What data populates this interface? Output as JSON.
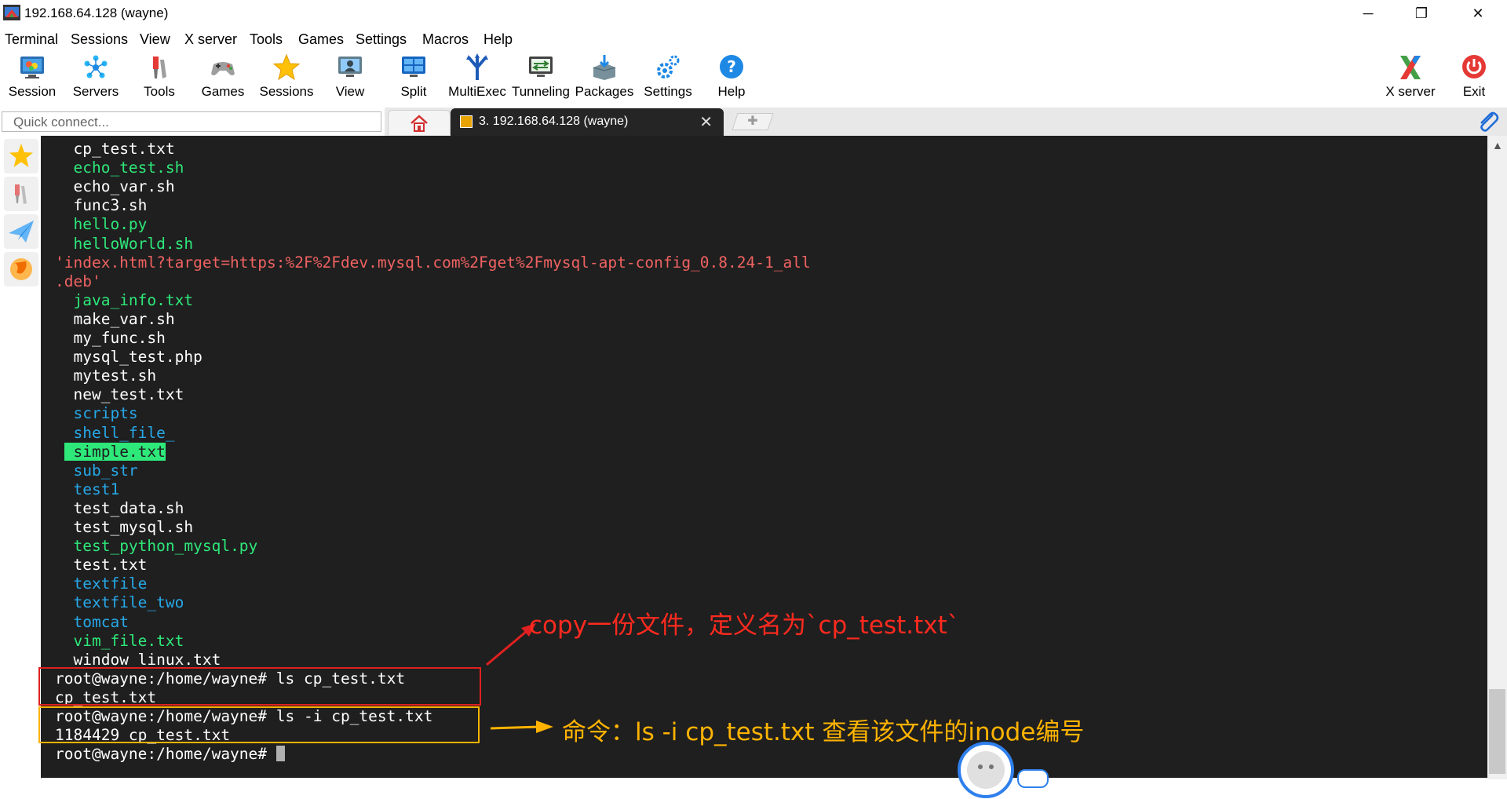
{
  "window": {
    "title": "192.168.64.128 (wayne)",
    "minimize_glyph": "─",
    "restore_glyph": "❐",
    "close_glyph": "✕"
  },
  "menu": [
    "Terminal",
    "Sessions",
    "View",
    "X server",
    "Tools",
    "Games",
    "Settings",
    "Macros",
    "Help"
  ],
  "toolbar": {
    "left": [
      {
        "label": "Session",
        "icon": "session-icon"
      },
      {
        "label": "Servers",
        "icon": "servers-icon"
      },
      {
        "label": "Tools",
        "icon": "tools-icon"
      },
      {
        "label": "Games",
        "icon": "games-icon"
      },
      {
        "label": "Sessions",
        "icon": "sessions-star-icon"
      },
      {
        "label": "View",
        "icon": "view-icon"
      },
      {
        "label": "Split",
        "icon": "split-icon"
      },
      {
        "label": "MultiExec",
        "icon": "multiexec-icon"
      },
      {
        "label": "Tunneling",
        "icon": "tunneling-icon"
      },
      {
        "label": "Packages",
        "icon": "packages-icon"
      },
      {
        "label": "Settings",
        "icon": "settings-icon"
      },
      {
        "label": "Help",
        "icon": "help-icon"
      }
    ],
    "right": [
      {
        "label": "X server",
        "icon": "x-server-icon"
      },
      {
        "label": "Exit",
        "icon": "exit-icon"
      }
    ]
  },
  "quick_connect": {
    "placeholder": "Quick connect..."
  },
  "tabs": {
    "session_label": "3. 192.168.64.128 (wayne)",
    "close_glyph": "✕",
    "new_tab_glyph": "✚"
  },
  "terminal": {
    "lines": [
      {
        "text": " cp_test.txt",
        "color": "#ffffff"
      },
      {
        "text": " echo_test.sh",
        "color": "#2ee87a"
      },
      {
        "text": " echo_var.sh",
        "color": "#ffffff"
      },
      {
        "text": " func3.sh",
        "color": "#ffffff"
      },
      {
        "text": " hello.py",
        "color": "#2ee87a"
      },
      {
        "text": " helloWorld.sh",
        "color": "#2ee87a"
      },
      {
        "text": "'index.html?target=https:%2F%2Fdev.mysql.com%2Fget%2Fmysql-apt-config_0.8.24-1_all",
        "color": "#f06262"
      },
      {
        "text": ".deb'",
        "color": "#f06262"
      },
      {
        "text": " java_info.txt",
        "color": "#2ee87a"
      },
      {
        "text": " make_var.sh",
        "color": "#ffffff"
      },
      {
        "text": " my_func.sh",
        "color": "#ffffff"
      },
      {
        "text": " mysql_test.php",
        "color": "#ffffff"
      },
      {
        "text": " mytest.sh",
        "color": "#ffffff"
      },
      {
        "text": " new_test.txt",
        "color": "#ffffff"
      },
      {
        "text": " scripts",
        "color": "#27a8e8"
      },
      {
        "text": " shell_file_",
        "color": "#27a8e8"
      },
      {
        "text": " simple.txt",
        "color": "#1e1e1e",
        "highlight": "#2ee87a"
      },
      {
        "text": " sub_str",
        "color": "#27a8e8"
      },
      {
        "text": " test1",
        "color": "#27a8e8"
      },
      {
        "text": " test_data.sh",
        "color": "#ffffff"
      },
      {
        "text": " test_mysql.sh",
        "color": "#ffffff"
      },
      {
        "text": " test_python_mysql.py",
        "color": "#2ee87a"
      },
      {
        "text": " test.txt",
        "color": "#ffffff"
      },
      {
        "text": " textfile",
        "color": "#27a8e8"
      },
      {
        "text": " textfile_two",
        "color": "#27a8e8"
      },
      {
        "text": " tomcat",
        "color": "#27a8e8"
      },
      {
        "text": " vim_file.txt",
        "color": "#2ee87a"
      },
      {
        "text": " window_linux.txt",
        "color": "#ffffff"
      },
      {
        "text": "root@wayne:/home/wayne# ls cp_test.txt",
        "color": "#ffffff"
      },
      {
        "text": "cp_test.txt",
        "color": "#ffffff"
      },
      {
        "text": "root@wayne:/home/wayne# ls -i cp_test.txt",
        "color": "#ffffff"
      },
      {
        "text": "1184429 cp_test.txt",
        "color": "#ffffff"
      },
      {
        "text": "root@wayne:/home/wayne# ",
        "color": "#ffffff",
        "cursor": true
      }
    ]
  },
  "annotations": {
    "copy_note": "copy一份文件，定义名为`cp_test.txt`",
    "copy_color": "#ff2a1f",
    "command_note": "命令：ls -i cp_test.txt 查看该文件的inode编号",
    "command_color": "#ffb300"
  }
}
